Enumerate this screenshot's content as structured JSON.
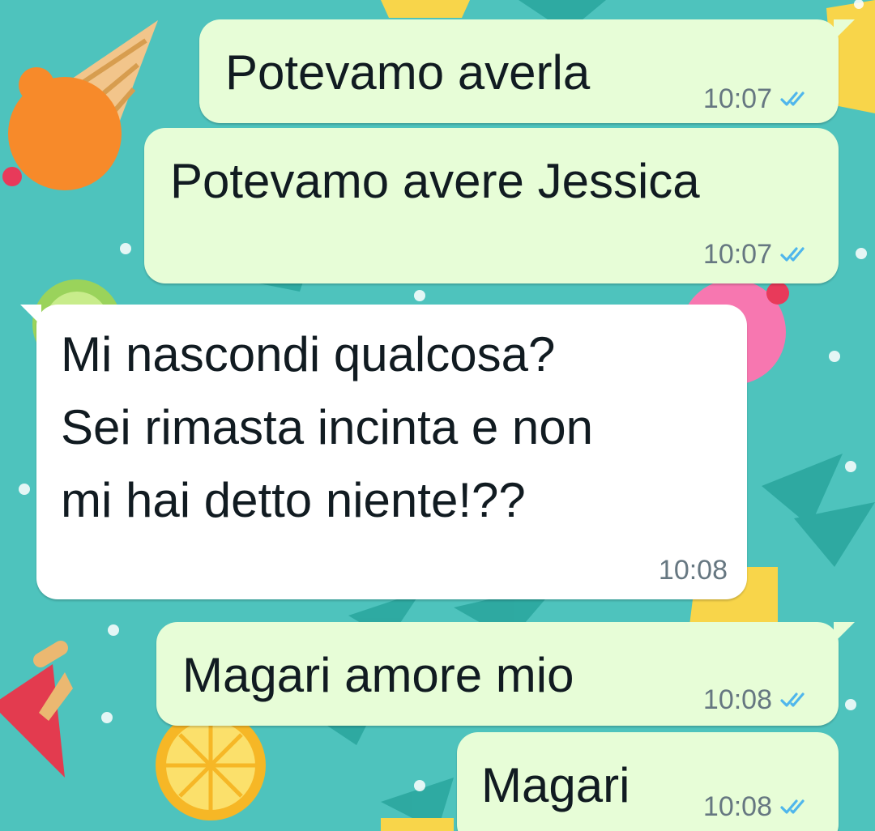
{
  "colors": {
    "wallpaper": "#4ec3bd",
    "outgoing_bubble": "#e7fdd7",
    "incoming_bubble": "#ffffff",
    "read_ticks": "#4fb6ec",
    "timestamp": "#667781"
  },
  "icons": {
    "read_receipt": "double-check-icon"
  },
  "messages": [
    {
      "direction": "outgoing",
      "text": "Potevamo averla",
      "time": "10:07",
      "status": "read"
    },
    {
      "direction": "outgoing",
      "text": "Potevamo avere Jessica",
      "time": "10:07",
      "status": "read"
    },
    {
      "direction": "incoming",
      "lines": [
        "Mi nascondi qualcosa?",
        "Sei rimasta incinta e non",
        "mi hai detto niente!??"
      ],
      "time": "10:08"
    },
    {
      "direction": "outgoing",
      "text": "Magari amore mio",
      "time": "10:08",
      "status": "read"
    },
    {
      "direction": "outgoing",
      "text": "Magari",
      "time": "10:08",
      "status": "read"
    }
  ]
}
